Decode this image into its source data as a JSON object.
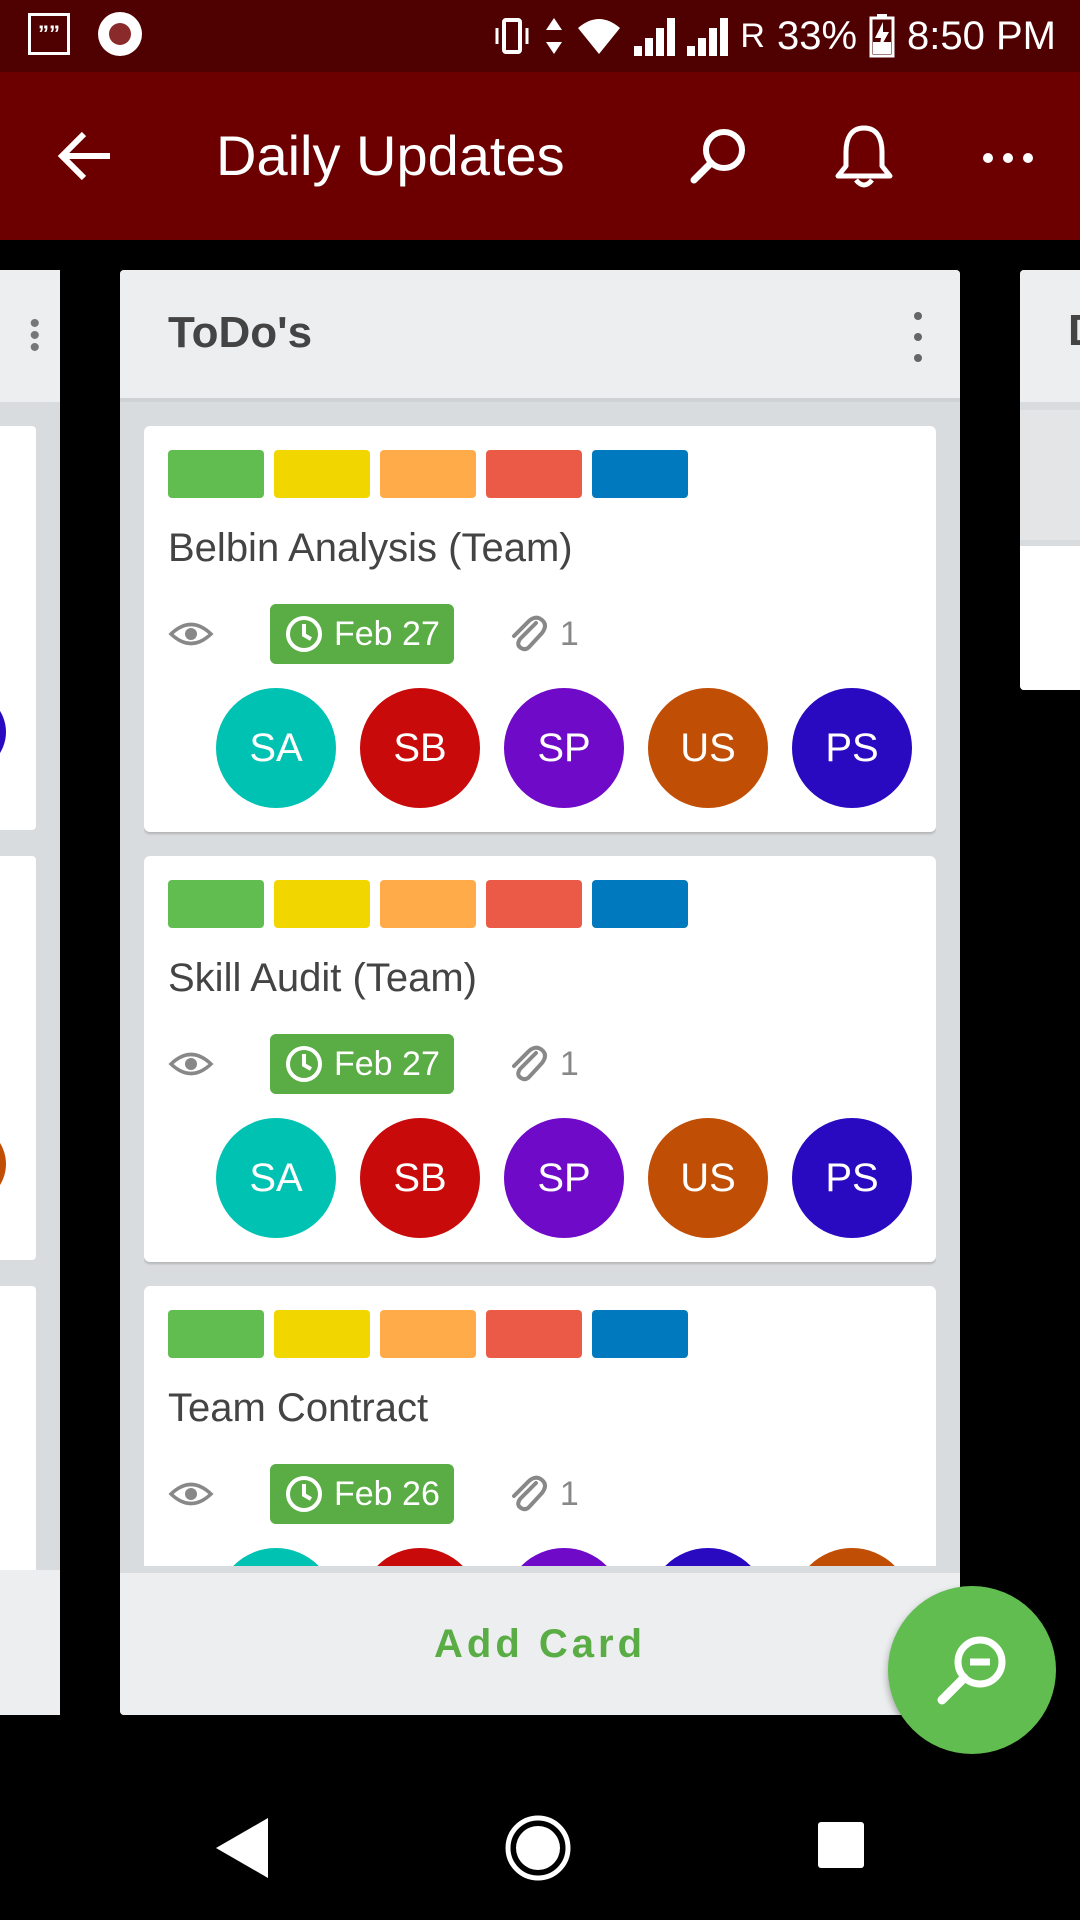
{
  "status_bar": {
    "left_box_glyph": "””",
    "battery": "33%",
    "time": "8:50 PM",
    "roaming": "R",
    "icons": [
      "vibrate-icon",
      "data-arrows-icon",
      "wifi-icon",
      "signal-icon",
      "signal-icon",
      "battery-icon"
    ]
  },
  "app_bar": {
    "title": "Daily Updates",
    "icons": [
      "back-arrow-icon",
      "search-icon",
      "bell-icon",
      "more-horizontal-icon"
    ]
  },
  "right_column_fragment": {
    "title_initial": "D"
  },
  "list": {
    "title": "ToDo's",
    "add_card_label": "Add Card",
    "label_colors": [
      "#61bd4f",
      "#f2d600",
      "#ffab4a",
      "#eb5a46",
      "#0079bf"
    ],
    "cards": [
      {
        "title": "Belbin Analysis (Team)",
        "due": "Feb 27",
        "attachments": "1",
        "members": [
          {
            "initials": "SA",
            "color": "#00c2b2"
          },
          {
            "initials": "SB",
            "color": "#c80a0a"
          },
          {
            "initials": "SP",
            "color": "#6f0ac8"
          },
          {
            "initials": "US",
            "color": "#c04e05"
          },
          {
            "initials": "PS",
            "color": "#2a0ac0"
          }
        ]
      },
      {
        "title": "Skill Audit (Team)",
        "due": "Feb 27",
        "attachments": "1",
        "members": [
          {
            "initials": "SA",
            "color": "#00c2b2"
          },
          {
            "initials": "SB",
            "color": "#c80a0a"
          },
          {
            "initials": "SP",
            "color": "#6f0ac8"
          },
          {
            "initials": "US",
            "color": "#c04e05"
          },
          {
            "initials": "PS",
            "color": "#2a0ac0"
          }
        ]
      },
      {
        "title": "Team Contract",
        "due": "Feb 26",
        "attachments": "1",
        "members": [
          {
            "initials": "",
            "color": "#00c2b2"
          },
          {
            "initials": "",
            "color": "#c80a0a"
          },
          {
            "initials": "",
            "color": "#6f0ac8"
          },
          {
            "initials": "",
            "color": "#2a0ac0"
          },
          {
            "initials": "",
            "color": "#c04e05"
          }
        ]
      }
    ]
  },
  "fab": {
    "icon": "zoom-out-icon",
    "color": "#61bd4f"
  },
  "colors": {
    "status_bar": "#4f0000",
    "app_bar": "#6c0000",
    "due_badge": "#5aac44",
    "list_bg": "#d9dcde",
    "list_header": "#eceef0"
  }
}
